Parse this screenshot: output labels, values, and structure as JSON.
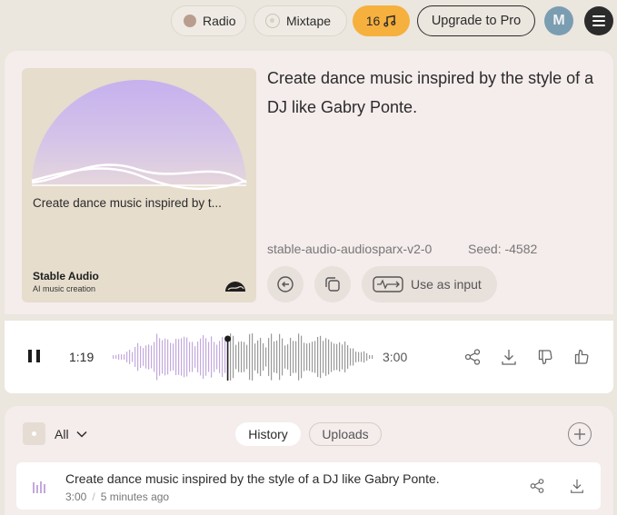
{
  "topbar": {
    "radio_label": "Radio",
    "mixtape_label": "Mixtape",
    "credits": "16",
    "upgrade_label": "Upgrade to Pro",
    "avatar_initial": "M",
    "credits_color": "#f6b03d",
    "avatar_color": "#7a9db2"
  },
  "generation": {
    "prompt": "Create dance music inspired by the style of a DJ like Gabry Ponte.",
    "artwork_caption": "Create dance music inspired by t...",
    "brand_name": "Stable Audio",
    "brand_tagline": "AI music creation",
    "model": "stable-audio-audiosparx-v2-0",
    "seed": "Seed: -4582",
    "use_as_input_label": "Use as input",
    "artwork_gradient": [
      "#c8b4ee",
      "#e2d2e0"
    ]
  },
  "player": {
    "current_time": "1:19",
    "total_time": "3:00",
    "progress": 0.44,
    "played_color": "#c3a9dd",
    "unplayed_color": "#9a9a9a"
  },
  "history": {
    "filter_label": "All",
    "tabs": [
      {
        "label": "History",
        "active": true
      },
      {
        "label": "Uploads",
        "active": false
      }
    ],
    "items": [
      {
        "title": "Create dance music inspired by the style of a DJ like Gabry Ponte.",
        "duration": "3:00",
        "age": "5 minutes ago"
      }
    ]
  }
}
